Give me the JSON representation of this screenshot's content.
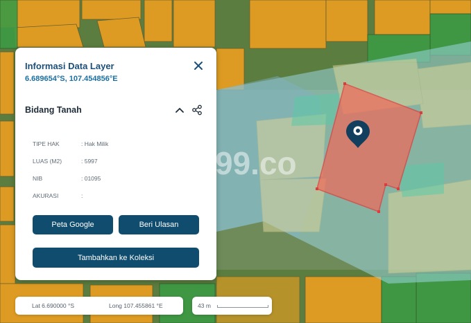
{
  "panel": {
    "title": "Informasi Data Layer",
    "coordinates": "6.689654°S, 107.454856°E",
    "section_title": "Bidang Tanah",
    "attributes": [
      {
        "key": "TIPE HAK",
        "value": ": Hak Milik"
      },
      {
        "key": "LUAS (M2)",
        "value": ": 5997"
      },
      {
        "key": "NIB",
        "value": ": 01095"
      },
      {
        "key": "AKURASI",
        "value": ":"
      }
    ],
    "buttons": {
      "google_map": "Peta Google",
      "review": "Beri Ulasan",
      "add_collection": "Tambahkan ke Koleksi"
    }
  },
  "footer": {
    "lat": "Lat 6.690000 °S",
    "long": "Long 107.455861 °E",
    "scale": "43 m"
  },
  "map": {
    "watermark": "99.co",
    "colors": {
      "parcel_orange": "#f0a020",
      "parcel_green": "#3c9a45",
      "highlight_band": "#9ad6e0",
      "selected_parcel": "#f06a5a",
      "selected_outline": "#e03b3b",
      "marker": "#123f5e"
    }
  },
  "theme": {
    "accent": "#0f4c6e",
    "title_color": "#1b4f7a"
  }
}
